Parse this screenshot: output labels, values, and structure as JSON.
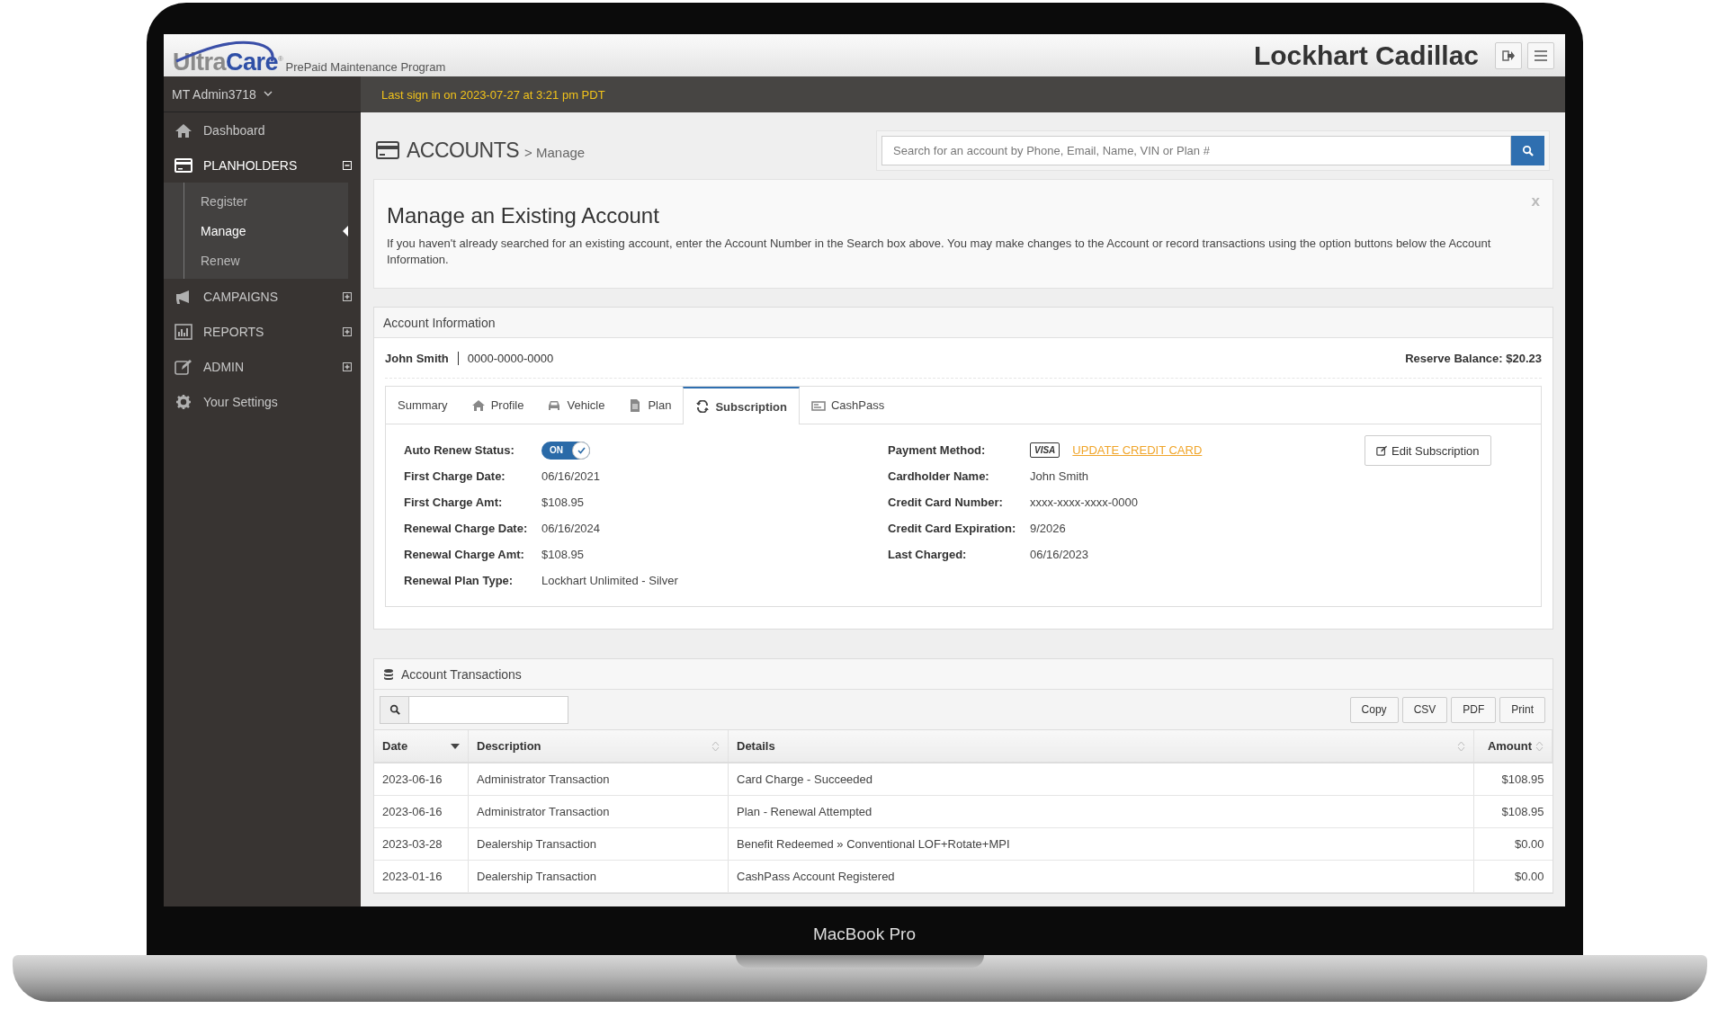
{
  "device": {
    "label": "MacBook Pro"
  },
  "header": {
    "brand_parts": [
      "Ultra",
      "Care$^{®}$"
    ],
    "tagline": "PrePaid Maintenance Program",
    "dealer": "Lockhart Cadillac"
  },
  "user_menu": {
    "label": "MT Admin3718"
  },
  "last_signin": "Last sign in on 2023-07-27 at 3:21 pm PDT",
  "sidebar": {
    "items": [
      {
        "label": "Dashboard",
        "kind": "link",
        "selected": false
      },
      {
        "label": "PLANHOLDERS",
        "kind": "group",
        "expanded": true,
        "selected": true,
        "children": [
          {
            "label": "Register",
            "selected": false
          },
          {
            "label": "Manage",
            "selected": true
          },
          {
            "label": "Renew",
            "selected": false
          }
        ]
      },
      {
        "label": "CAMPAIGNS",
        "kind": "group",
        "expanded": false,
        "selected": false
      },
      {
        "label": "REPORTS",
        "kind": "group",
        "expanded": false,
        "selected": false
      },
      {
        "label": "ADMIN",
        "kind": "group",
        "expanded": false,
        "selected": false
      },
      {
        "label": "Your Settings",
        "kind": "link",
        "selected": false
      }
    ]
  },
  "page": {
    "title": "ACCOUNTS",
    "breadcrumb": "> Manage"
  },
  "search": {
    "placeholder": "Search for an account by Phone, Email, Name, VIN or Plan #"
  },
  "notice": {
    "title": "Manage an Existing Account",
    "text": "If you haven't already searched for an existing account, enter the Account Number in the Search box above. You may make changes to the Account or record transactions using the option buttons below the Account Information.",
    "close": "x"
  },
  "account": {
    "title": "Account Information",
    "name": "John Smith",
    "number": "0000-0000-0000",
    "reserve": "Reserve Balance: $20.23",
    "tabs": [
      {
        "label": "Summary",
        "selected": false
      },
      {
        "label": "Profile",
        "selected": false
      },
      {
        "label": "Vehicle",
        "selected": false
      },
      {
        "label": "Plan",
        "selected": false
      },
      {
        "label": "Subscription",
        "selected": true
      },
      {
        "label": "CashPass",
        "selected": false
      }
    ],
    "left_fields": [
      {
        "label": "Auto Renew Status:",
        "kind": "toggle",
        "on": true,
        "value": "ON"
      },
      {
        "label": "First Charge Date:",
        "kind": "text",
        "value": "06/16/2021"
      },
      {
        "label": "First Charge Amt:",
        "kind": "text",
        "value": "$108.95"
      },
      {
        "label": "Renewal Charge Date:",
        "kind": "text",
        "value": "06/16/2024"
      },
      {
        "label": "Renewal Charge Amt:",
        "kind": "text",
        "value": "$108.95"
      },
      {
        "label": "Renewal Plan Type:",
        "kind": "text",
        "value": "Lockhart Unlimited - Silver"
      }
    ],
    "right_fields": [
      {
        "label": "Payment Method:",
        "kind": "card",
        "value": "VISA",
        "link": "UPDATE CREDIT CARD"
      },
      {
        "label": "Cardholder Name:",
        "kind": "text",
        "value": "John Smith"
      },
      {
        "label": "Credit Card Number:",
        "kind": "text",
        "value": "xxxx-xxxx-xxxx-0000"
      },
      {
        "label": "Credit Card Expiration:",
        "kind": "text",
        "value": "9/2026"
      },
      {
        "label": "Last Charged:",
        "kind": "text",
        "value": "06/16/2023"
      }
    ],
    "edit_button": "Edit Subscription"
  },
  "transactions": {
    "title": "Account Transactions",
    "buttons": [
      "Copy",
      "CSV",
      "PDF",
      "Print"
    ],
    "columns": [
      {
        "label": "Date",
        "sorted": true
      },
      {
        "label": "Description",
        "sorted": false
      },
      {
        "label": "Details",
        "sorted": false
      },
      {
        "label": "Amount",
        "sorted": false
      }
    ],
    "rows": [
      [
        "2023-06-16",
        "Administrator Transaction",
        "Card Charge - Succeeded",
        "$108.95"
      ],
      [
        "2023-06-16",
        "Administrator Transaction",
        "Plan - Renewal Attempted",
        "$108.95"
      ],
      [
        "2023-03-28",
        "Dealership Transaction",
        "Benefit Redeemed » Conventional LOF+Rotate+MPI",
        "$0.00"
      ],
      [
        "2023-01-16",
        "Dealership Transaction",
        "CashPass Account Registered",
        "$0.00"
      ]
    ]
  }
}
